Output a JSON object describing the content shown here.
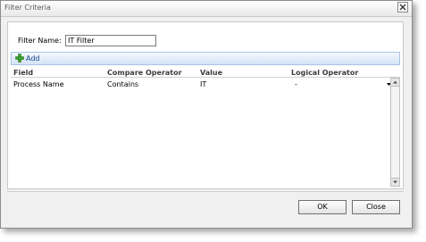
{
  "dialog": {
    "title": "Filter Criteria",
    "close_glyph": "×"
  },
  "filter_name": {
    "label": "Filter Name:",
    "value": "IT Filter"
  },
  "toolbar": {
    "add_label": "Add",
    "add_icon": "green-plus-icon"
  },
  "grid": {
    "columns": [
      "Field",
      "Compare Operator",
      "Value",
      "Logical Operator"
    ],
    "rows": [
      {
        "field": "Process Name",
        "operator": "Contains",
        "value": "IT",
        "logical": "-"
      }
    ]
  },
  "footer": {
    "ok_label": "OK",
    "close_label": "Close"
  },
  "colors": {
    "toolbar_gradient_top": "#f4f8fd",
    "toolbar_gradient_bottom": "#d4e3f7",
    "add_text": "#15428b",
    "plus_icon": "#3aa32e"
  }
}
